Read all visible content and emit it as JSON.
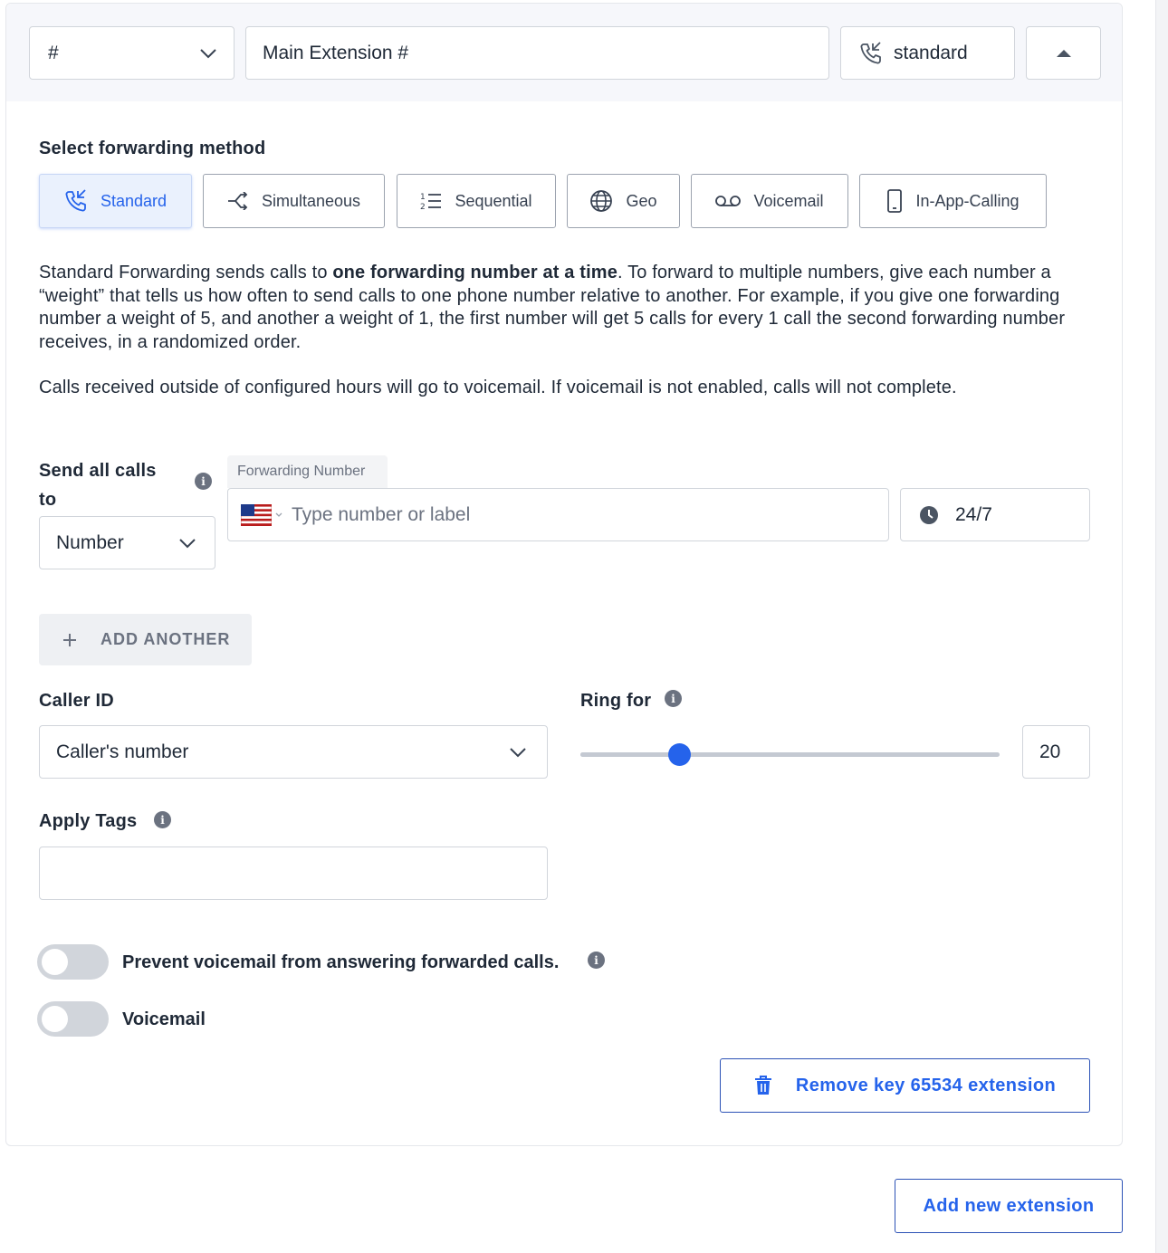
{
  "header": {
    "key_value": "#",
    "extension_name": "Main Extension #",
    "method_label": "standard"
  },
  "forwarding": {
    "section_label": "Select forwarding method",
    "methods": [
      {
        "label": "Standard",
        "icon": "phone-forward-icon",
        "active": true
      },
      {
        "label": "Simultaneous",
        "icon": "split-arrows-icon",
        "active": false
      },
      {
        "label": "Sequential",
        "icon": "numbered-list-icon",
        "active": false
      },
      {
        "label": "Geo",
        "icon": "globe-icon",
        "active": false
      },
      {
        "label": "Voicemail",
        "icon": "voicemail-icon",
        "active": false
      },
      {
        "label": "In-App-Calling",
        "icon": "mobile-phone-icon",
        "active": false
      }
    ],
    "description": {
      "part1": "Standard Forwarding sends calls to ",
      "bold": "one forwarding number at a time",
      "part2": ". To forward to multiple numbers, give each number a “weight” that tells us how often to send calls to one phone number relative to another. For example, if you give one forwarding number a weight of 5, and another a weight of 1, the first number will get 5 calls for every 1 call the second forwarding number receives, in a randomized order."
    },
    "hours_note": "Calls received outside of configured hours will go to voicemail. If voicemail is not enabled, calls will not complete."
  },
  "send_calls": {
    "label": "Send all calls to",
    "target_type": "Number",
    "forwarding_tab": "Forwarding Number",
    "number_placeholder": "Type number or label",
    "schedule": "24/7"
  },
  "add_another_label": "ADD ANOTHER",
  "caller_id": {
    "label": "Caller ID",
    "value": "Caller's number"
  },
  "ring_for": {
    "label": "Ring for",
    "value": "20",
    "slider_fraction": 0.235
  },
  "apply_tags": {
    "label": "Apply Tags",
    "value": ""
  },
  "toggles": {
    "prevent_voicemail": {
      "label": "Prevent voicemail from answering forwarded calls.",
      "on": false
    },
    "voicemail": {
      "label": "Voicemail",
      "on": false
    }
  },
  "remove_button_label": "Remove key 65534 extension",
  "add_extension_label": "Add new extension",
  "colors": {
    "accent": "#2563eb",
    "header_bg": "#f6f7fb",
    "active_bg": "#eaf1fd"
  }
}
